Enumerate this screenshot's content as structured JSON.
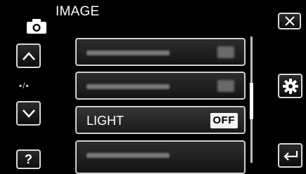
{
  "header": {
    "title": "IMAGE",
    "mode_icon": "camera-icon"
  },
  "left_nav": {
    "up_icon": "chevron-up-icon",
    "page_indicator": "▪/▪",
    "down_icon": "chevron-down-icon",
    "help_label": "?"
  },
  "menu": {
    "items": [
      {
        "label": "",
        "value": "",
        "obscured": true
      },
      {
        "label": "",
        "value": "",
        "obscured": true
      },
      {
        "label": "LIGHT",
        "value": "OFF",
        "obscured": false
      },
      {
        "label": "",
        "value": "",
        "obscured": true
      }
    ]
  },
  "right_nav": {
    "close_icon": "close-icon",
    "settings_icon": "gear-icon",
    "back_icon": "return-arrow-icon"
  }
}
